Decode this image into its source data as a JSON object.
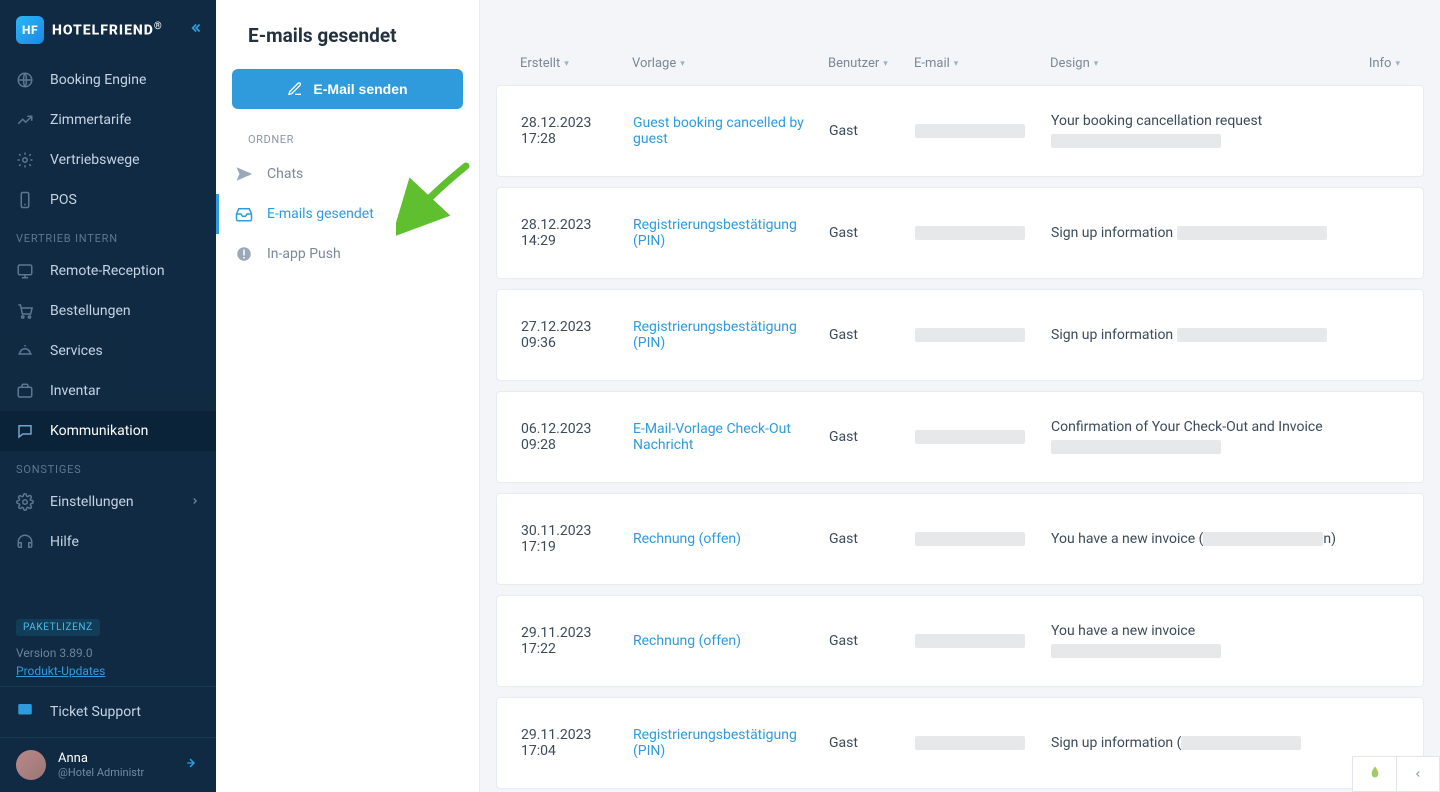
{
  "brand": {
    "badge": "HF",
    "name": "HOTELFRIEND",
    "reg": "®"
  },
  "sidebar": {
    "sections": {
      "main": [
        {
          "id": "booking-engine",
          "label": "Booking Engine",
          "icon": "globe"
        },
        {
          "id": "zimmertarife",
          "label": "Zimmertarife",
          "icon": "chart"
        },
        {
          "id": "vertriebswege",
          "label": "Vertriebswege",
          "icon": "gear"
        },
        {
          "id": "pos",
          "label": "POS",
          "icon": "phone"
        }
      ],
      "vertrieb_title": "VERTRIEB INTERN",
      "vertrieb": [
        {
          "id": "remote-reception",
          "label": "Remote-Reception",
          "icon": "screen"
        },
        {
          "id": "bestellungen",
          "label": "Bestellungen",
          "icon": "cart"
        },
        {
          "id": "services",
          "label": "Services",
          "icon": "cloche"
        },
        {
          "id": "inventar",
          "label": "Inventar",
          "icon": "briefcase"
        },
        {
          "id": "kommunikation",
          "label": "Kommunikation",
          "icon": "chat",
          "active": true
        }
      ],
      "sonstiges_title": "SONSTIGES",
      "sonstiges": [
        {
          "id": "einstellungen",
          "label": "Einstellungen",
          "icon": "cog",
          "chevron": true
        },
        {
          "id": "hilfe",
          "label": "Hilfe",
          "icon": "help"
        }
      ]
    },
    "license": {
      "badge": "PAKETLIZENZ",
      "version": "Version 3.89.0",
      "updates": "Produkt-Updates"
    },
    "support": {
      "label": "Ticket Support"
    },
    "user": {
      "name": "Anna",
      "role": "@Hotel Administr"
    }
  },
  "panel": {
    "title": "E-mails gesendet",
    "compose_label": "E-Mail senden",
    "section_label": "ORDNER",
    "folders": [
      {
        "id": "chats",
        "label": "Chats",
        "icon": "send"
      },
      {
        "id": "emails-sent",
        "label": "E-mails gesendet",
        "icon": "inbox",
        "active": true
      },
      {
        "id": "inapp-push",
        "label": "In-app Push",
        "icon": "alert"
      }
    ]
  },
  "table": {
    "columns": {
      "created": "Erstellt",
      "template": "Vorlage",
      "user": "Benutzer",
      "email": "E-mail",
      "design": "Design",
      "info": "Info"
    },
    "rows": [
      {
        "created_date": "28.12.2023",
        "created_time": "17:28",
        "template": "Guest booking cancelled by guest",
        "user": "Gast",
        "design": "Your booking cancellation request",
        "design_sub_redacted": true
      },
      {
        "created_date": "28.12.2023",
        "created_time": "14:29",
        "template": "Registrierungsbestätigung (PIN)",
        "user": "Gast",
        "design": "Sign up information",
        "design_trail_redacted": true
      },
      {
        "created_date": "27.12.2023",
        "created_time": "09:36",
        "template": "Registrierungsbestätigung (PIN)",
        "user": "Gast",
        "design": "Sign up information",
        "design_trail_redacted": true
      },
      {
        "created_date": "06.12.2023",
        "created_time": "09:28",
        "template": "E-Mail-Vorlage Check-Out Nachricht",
        "user": "Gast",
        "design": "Confirmation of Your Check-Out and Invoice",
        "design_sub_redacted": true
      },
      {
        "created_date": "30.11.2023",
        "created_time": "17:19",
        "template": "Rechnung (offen)",
        "user": "Gast",
        "design_pre": "You have a new invoice (",
        "design_mid_redacted": true,
        "design_post": "n)"
      },
      {
        "created_date": "29.11.2023",
        "created_time": "17:22",
        "template": "Rechnung (offen)",
        "user": "Gast",
        "design": "You have a new invoice",
        "design_sub_redacted": true
      },
      {
        "created_date": "29.11.2023",
        "created_time": "17:04",
        "template": "Registrierungsbestätigung (PIN)",
        "user": "Gast",
        "design_pre": "Sign up information (",
        "design_mid_redacted": true
      }
    ]
  }
}
